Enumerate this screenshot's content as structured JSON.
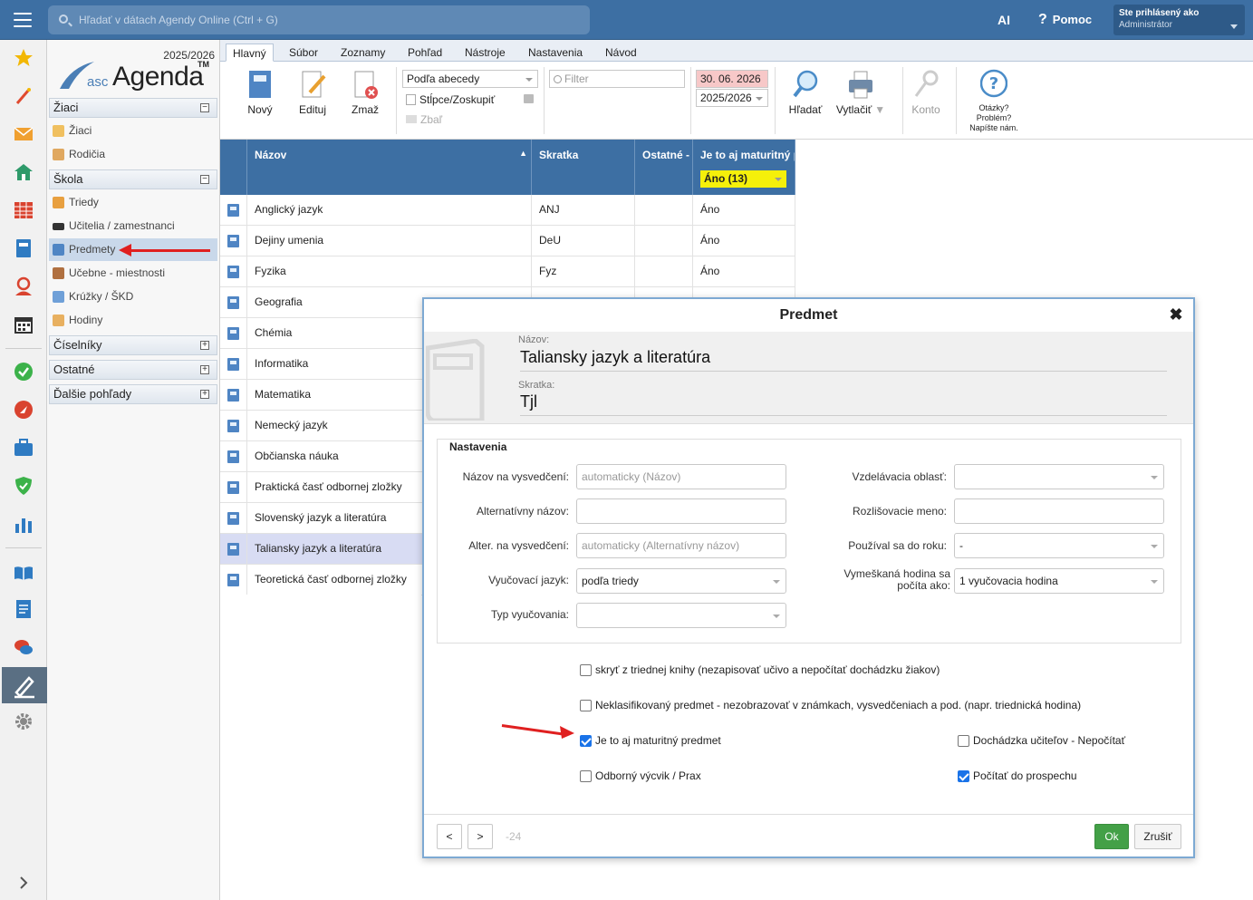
{
  "topbar": {
    "search_placeholder": "Hľadať v dátach Agendy Online (Ctrl + G)",
    "ai_label": "AI",
    "help_label": "Pomoc",
    "user_line1": "Ste prihlásený ako",
    "user_line2": "Administrátor"
  },
  "logo": {
    "year": "2025/2026",
    "asc": "asc",
    "agenda": "Agenda",
    "tm": "TM"
  },
  "sidebar": {
    "sections": [
      {
        "label": "Žiaci",
        "toggle": "−"
      },
      {
        "label": "Škola",
        "toggle": "−"
      },
      {
        "label": "Číselníky",
        "toggle": "+"
      },
      {
        "label": "Ostatné",
        "toggle": "+"
      },
      {
        "label": "Ďalšie pohľady",
        "toggle": "+"
      }
    ],
    "items": [
      {
        "label": "Žiaci"
      },
      {
        "label": "Rodičia"
      },
      {
        "label": "Triedy"
      },
      {
        "label": "Učitelia / zamestnanci"
      },
      {
        "label": "Predmety"
      },
      {
        "label": "Učebne - miestnosti"
      },
      {
        "label": "Krúžky / ŠKD"
      },
      {
        "label": "Hodiny"
      }
    ]
  },
  "tabs": [
    "Hlavný",
    "Súbor",
    "Zoznamy",
    "Pohľad",
    "Nástroje",
    "Nastavenia",
    "Návod"
  ],
  "ribbon": {
    "new": "Nový",
    "edit": "Edituj",
    "delete": "Zmaž",
    "sort": "Podľa abecedy",
    "columns": "Stĺpce/Zoskupiť",
    "collapse": "Zbaľ",
    "filter_placeholder": "Filter",
    "date": "30. 06. 2026",
    "year": "2025/2026",
    "search": "Hľadať",
    "print": "Vytlačiť",
    "account": "Konto",
    "help1": "Otázky?",
    "help2": "Problém?",
    "help3": "Napíšte nám."
  },
  "grid": {
    "headers": [
      "Názov",
      "Skratka",
      "Ostatné -",
      "Je to aj maturitný p"
    ],
    "filter_value": "Áno (13)",
    "rows": [
      {
        "name": "Anglický jazyk",
        "abbr": "ANJ",
        "mat": "Áno"
      },
      {
        "name": "Dejiny umenia",
        "abbr": "DeU",
        "mat": "Áno"
      },
      {
        "name": "Fyzika",
        "abbr": "Fyz",
        "mat": "Áno"
      },
      {
        "name": "Geografia",
        "abbr": "",
        "mat": ""
      },
      {
        "name": "Chémia",
        "abbr": "",
        "mat": ""
      },
      {
        "name": "Informatika",
        "abbr": "",
        "mat": ""
      },
      {
        "name": "Matematika",
        "abbr": "",
        "mat": ""
      },
      {
        "name": "Nemecký jazyk",
        "abbr": "",
        "mat": ""
      },
      {
        "name": "Občianska náuka",
        "abbr": "",
        "mat": ""
      },
      {
        "name": "Praktická časť odbornej zložky",
        "abbr": "",
        "mat": ""
      },
      {
        "name": "Slovenský jazyk a literatúra",
        "abbr": "",
        "mat": ""
      },
      {
        "name": "Taliansky jazyk a literatúra",
        "abbr": "",
        "mat": ""
      },
      {
        "name": "Teoretická časť odbornej zložky",
        "abbr": "",
        "mat": ""
      }
    ]
  },
  "dialog": {
    "title": "Predmet",
    "close": "✖",
    "name_label": "Názov:",
    "name_value": "Taliansky jazyk a literatúra",
    "abbr_label": "Skratka:",
    "abbr_value": "Tjl",
    "fieldset_legend": "Nastavenia",
    "left_fields": [
      {
        "label": "Názov na vysvedčení:",
        "value": "automaticky (Názov)"
      },
      {
        "label": "Alternatívny názov:",
        "value": ""
      },
      {
        "label": "Alter. na vysvedčení:",
        "value": "automaticky (Alternatívny názov)"
      },
      {
        "label": "Vyučovací jazyk:",
        "value": "podľa triedy"
      },
      {
        "label": "Typ vyučovania:",
        "value": ""
      }
    ],
    "right_fields": [
      {
        "label": "Vzdelávacia oblasť:",
        "value": ""
      },
      {
        "label": "Rozlišovacie meno:",
        "value": ""
      },
      {
        "label": "Používal sa do roku:",
        "value": "-"
      },
      {
        "label": "Vymeškaná hodina sa",
        "label2": "počíta ako:",
        "value": "1 vyučovacia hodina"
      }
    ],
    "checkboxes": {
      "hide": "skryť z triednej knihy (nezapisovať učivo a nepočítať dochádzku žiakov)",
      "unclassified": "Neklasifikovaný predmet - nezobrazovať v známkach, vysvedčeniach a pod. (napr. triednická hodina)",
      "maturitny": "Je to aj maturitný predmet",
      "attendance": "Dochádzka učiteľov - Nepočítať",
      "odborny": "Odborný výcvik / Prax",
      "prospech": "Počítať do prospechu"
    },
    "prev": "<",
    "next": ">",
    "record_id": "-24",
    "ok": "Ok",
    "cancel": "Zrušiť"
  },
  "colors": {
    "topbar": "#3d6fa3",
    "accent": "#3d6fa3",
    "ok": "#43a047",
    "filter_yellow": "#f5f00a",
    "arrow": "#e02020"
  }
}
